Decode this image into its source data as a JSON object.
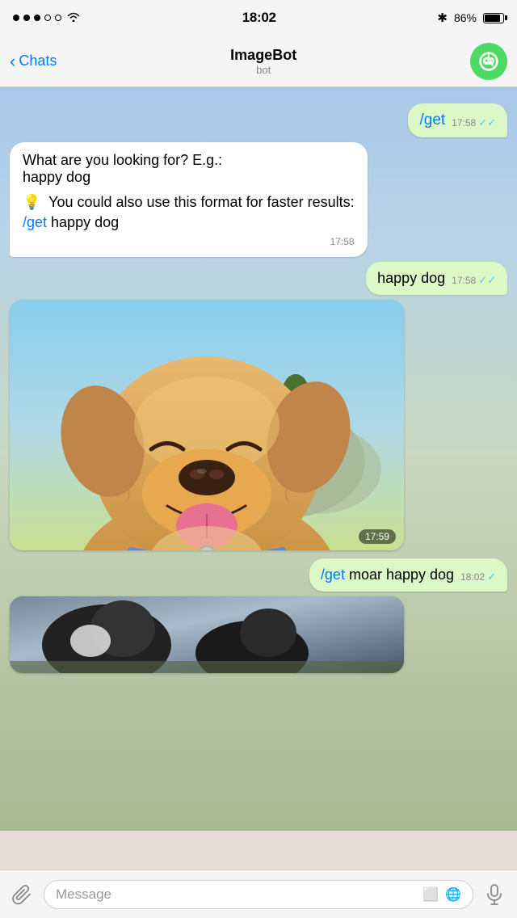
{
  "statusBar": {
    "time": "18:02",
    "batteryPercent": "86%",
    "bluetooth": "✱"
  },
  "navBar": {
    "backLabel": "Chats",
    "title": "ImageBot",
    "subtitle": "bot"
  },
  "messages": [
    {
      "id": "msg1",
      "type": "outgoing",
      "text": "/get",
      "time": "17:58",
      "checks": "✓✓"
    },
    {
      "id": "msg2",
      "type": "incoming",
      "lines": [
        "What are you looking for? E.g.: happy dog",
        "",
        "💡  You could also use this format for faster results:",
        "/get happy dog"
      ],
      "time": "17:58"
    },
    {
      "id": "msg3",
      "type": "outgoing",
      "text": "happy dog",
      "time": "17:58",
      "checks": "✓✓"
    },
    {
      "id": "msg4",
      "type": "image",
      "time": "17:59"
    },
    {
      "id": "msg5",
      "type": "outgoing",
      "cmdPart": "/get",
      "textPart": " moar happy dog",
      "time": "18:02",
      "checks": "✓"
    },
    {
      "id": "msg6",
      "type": "image2"
    }
  ],
  "inputBar": {
    "placeholder": "Message"
  }
}
